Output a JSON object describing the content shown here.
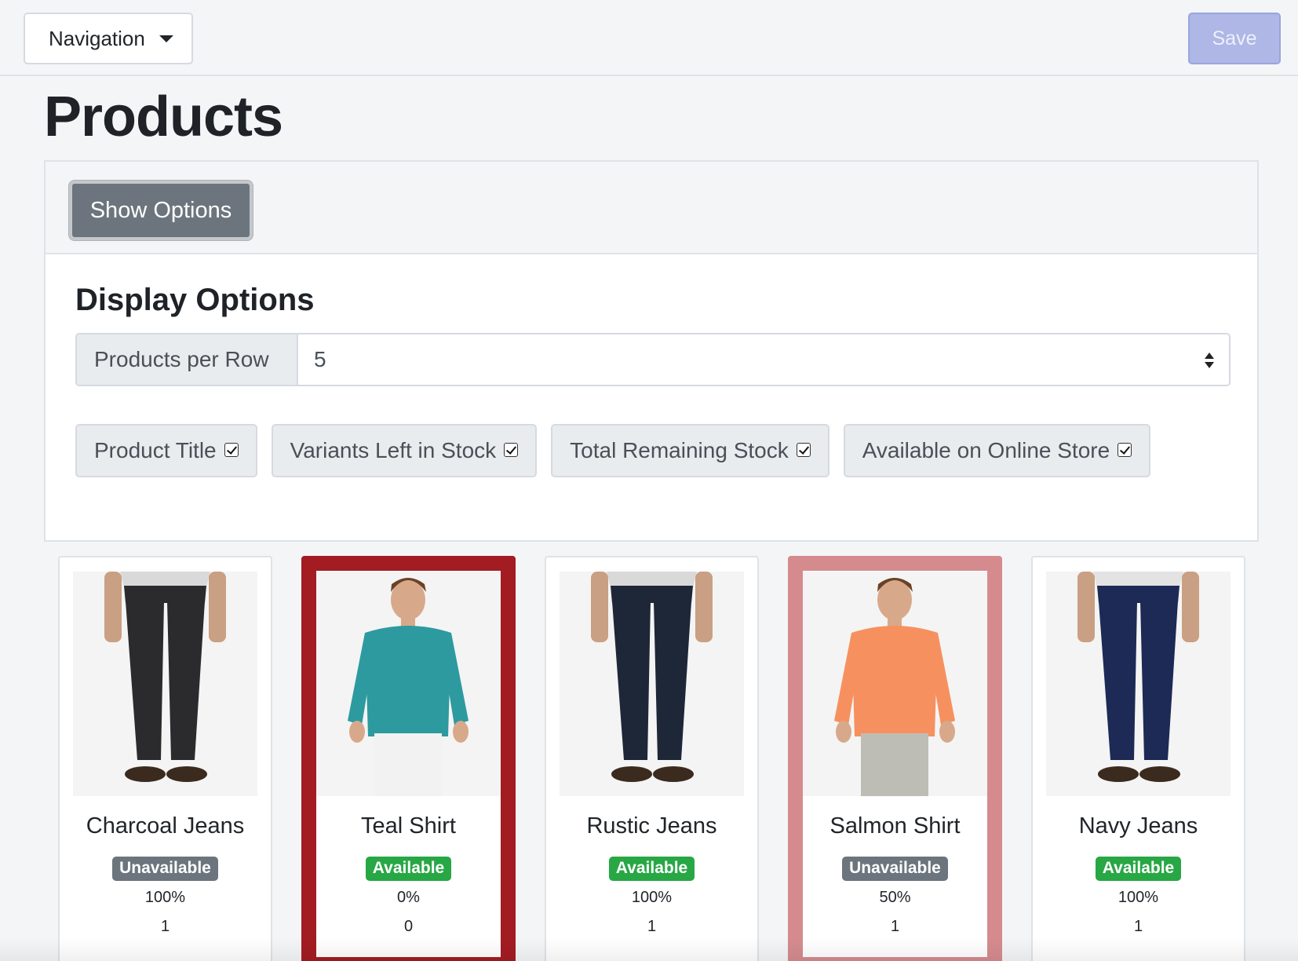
{
  "topbar": {
    "navigation_label": "Navigation",
    "save_label": "Save"
  },
  "page": {
    "title": "Products"
  },
  "options": {
    "show_options_label": "Show Options",
    "display_title": "Display Options",
    "per_row_label": "Products per Row",
    "per_row_value": "5",
    "toggles": [
      {
        "label": "Product Title",
        "checked": true
      },
      {
        "label": "Variants Left in Stock",
        "checked": true
      },
      {
        "label": "Total Remaining Stock",
        "checked": true
      },
      {
        "label": "Available on Online Store",
        "checked": true
      }
    ]
  },
  "products": [
    {
      "title": "Charcoal Jeans",
      "status": "Unavailable",
      "variants_pct": "100%",
      "stock": "1",
      "highlight": "none",
      "pants": "#2b2b2d",
      "shirt": "#d9d9d9",
      "kind": "jeans"
    },
    {
      "title": "Teal Shirt",
      "status": "Available",
      "variants_pct": "0%",
      "stock": "0",
      "highlight": "strong",
      "pants": "#f2f2f2",
      "shirt": "#2d9aa0",
      "kind": "shirt"
    },
    {
      "title": "Rustic Jeans",
      "status": "Available",
      "variants_pct": "100%",
      "stock": "1",
      "highlight": "none",
      "pants": "#1e2738",
      "shirt": "#d9d9d9",
      "kind": "jeans"
    },
    {
      "title": "Salmon Shirt",
      "status": "Unavailable",
      "variants_pct": "50%",
      "stock": "1",
      "highlight": "soft",
      "pants": "#bdbdb6",
      "shirt": "#f6915f",
      "kind": "shirt"
    },
    {
      "title": "Navy Jeans",
      "status": "Available",
      "variants_pct": "100%",
      "stock": "1",
      "highlight": "none",
      "pants": "#1c2a55",
      "shirt": "#e3e3e3",
      "kind": "jeans"
    }
  ],
  "colors": {
    "available": "#28a745",
    "unavailable": "#6c757d",
    "highlight_strong": "#a31c22",
    "highlight_soft": "#d58b8e",
    "save_button": "#aeb7e6"
  }
}
